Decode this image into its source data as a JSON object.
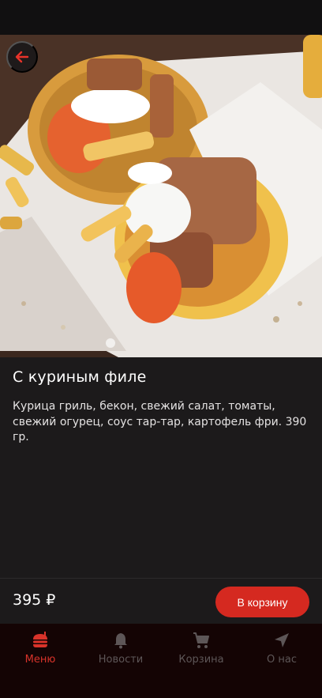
{
  "product": {
    "title": "С куриным филе",
    "description": "Курица гриль, бекон, свежий салат, томаты, свежий огурец, соус тар-тар, картофель фри. 390 гр.",
    "price": "395 ₽"
  },
  "actions": {
    "add_to_cart_label": "В корзину"
  },
  "nav": {
    "items": [
      {
        "label": "Меню",
        "icon": "burger-icon",
        "active": true
      },
      {
        "label": "Новости",
        "icon": "bell-icon",
        "active": false
      },
      {
        "label": "Корзина",
        "icon": "cart-icon",
        "active": false
      },
      {
        "label": "О нас",
        "icon": "location-arrow-icon",
        "active": false
      }
    ]
  },
  "colors": {
    "accent": "#d52920",
    "background": "#1c1a1b",
    "nav_background": "#140404",
    "nav_inactive": "#5d5657"
  }
}
